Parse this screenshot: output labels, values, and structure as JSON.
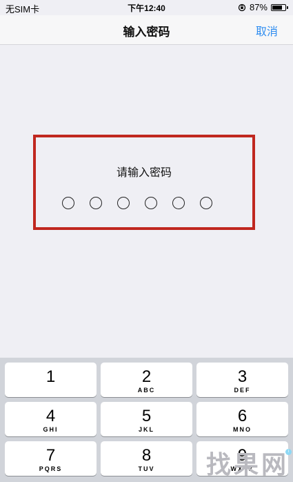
{
  "status_bar": {
    "carrier": "无SIM卡",
    "time": "下午12:40",
    "battery_percent": "87%",
    "battery_level": 0.87
  },
  "nav": {
    "title": "输入密码",
    "cancel_label": "取消",
    "accent_color": "#2d8cf0"
  },
  "password": {
    "prompt": "请输入密码",
    "length": 6,
    "entered": 0,
    "highlight_color": "#c0271f"
  },
  "keypad": {
    "keys": [
      {
        "num": "1",
        "letters": ""
      },
      {
        "num": "2",
        "letters": "ABC"
      },
      {
        "num": "3",
        "letters": "DEF"
      },
      {
        "num": "4",
        "letters": "GHI"
      },
      {
        "num": "5",
        "letters": "JKL"
      },
      {
        "num": "6",
        "letters": "MNO"
      },
      {
        "num": "7",
        "letters": "PQRS"
      },
      {
        "num": "8",
        "letters": "TUV"
      },
      {
        "num": "9",
        "letters": "WXYZ"
      }
    ]
  },
  "watermark": "找果网"
}
